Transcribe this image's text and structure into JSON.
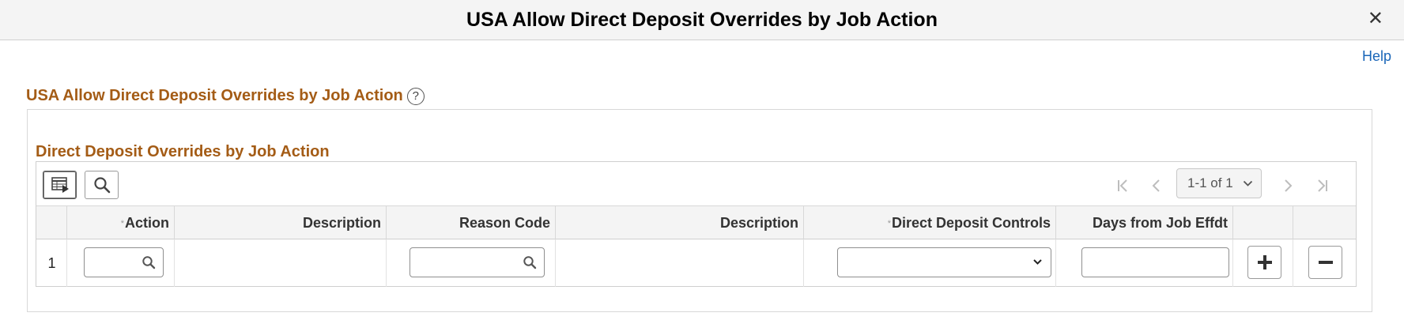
{
  "window": {
    "title": "USA Allow Direct Deposit Overrides by Job Action",
    "close_glyph": "✕"
  },
  "help_link": "Help",
  "page": {
    "heading": "USA Allow Direct Deposit Overrides by Job Action",
    "help_icon_glyph": "?"
  },
  "grid": {
    "title": "Direct Deposit Overrides by Job Action",
    "pager_label": "1-1 of 1",
    "columns": [
      {
        "label": "Action",
        "required": true
      },
      {
        "label": "Description",
        "required": false
      },
      {
        "label": "Reason Code",
        "required": false
      },
      {
        "label": "Description",
        "required": false
      },
      {
        "label": "Direct Deposit Controls",
        "required": true
      },
      {
        "label": "Days from Job Effdt",
        "required": false
      }
    ],
    "required_marker": "*",
    "rows": [
      {
        "number": "1",
        "action": "",
        "description": "",
        "reason_code": "",
        "description2": "",
        "direct_deposit_controls": "",
        "days_from_job_effdt": ""
      }
    ]
  },
  "icons": {
    "close": "close-icon",
    "help": "question-circle-icon",
    "personalize": "personalize-grid-icon",
    "find": "search-icon",
    "first": "first-page-icon",
    "prev": "previous-page-icon",
    "next": "next-page-icon",
    "last": "last-page-icon",
    "add": "plus-icon",
    "delete": "minus-icon"
  },
  "colors": {
    "section_heading": "#a45c16",
    "link": "#1a66b8",
    "header_bg": "#f4f4f4"
  }
}
